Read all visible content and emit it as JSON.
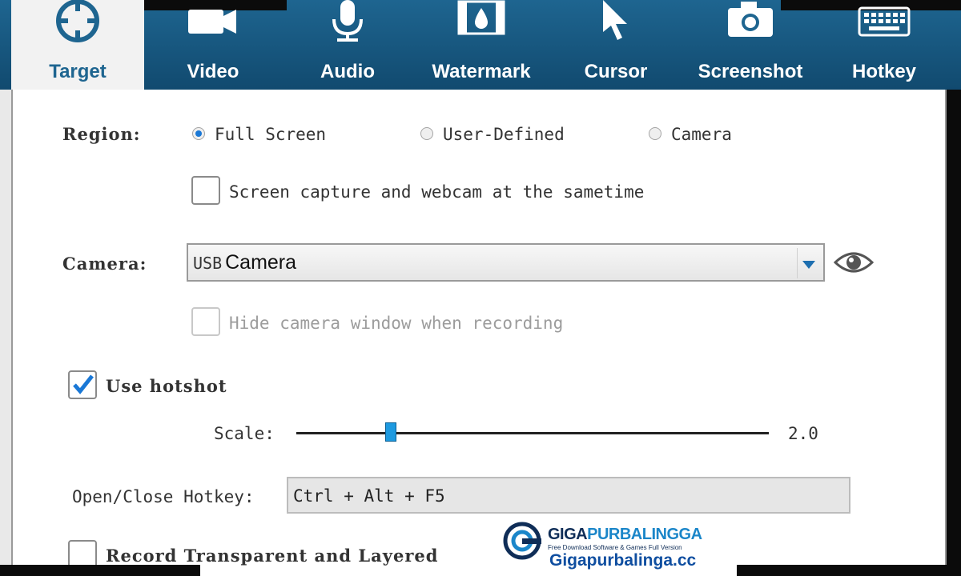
{
  "tabs": [
    {
      "label": "Target",
      "icon": "target-icon",
      "active": true
    },
    {
      "label": "Video",
      "icon": "video-camera-icon"
    },
    {
      "label": "Audio",
      "icon": "microphone-icon"
    },
    {
      "label": "Watermark",
      "icon": "watermark-film-icon"
    },
    {
      "label": "Cursor",
      "icon": "cursor-arrow-icon"
    },
    {
      "label": "Screenshot",
      "icon": "camera-icon"
    },
    {
      "label": "Hotkey",
      "icon": "keyboard-icon"
    }
  ],
  "region": {
    "label": "Region:",
    "options": [
      {
        "label": "Full Screen",
        "selected": true
      },
      {
        "label": "User-Defined",
        "selected": false
      },
      {
        "label": "Camera",
        "selected": false
      }
    ],
    "webcam_checkbox_label": "Screen capture and webcam at the sametime"
  },
  "camera": {
    "label": "Camera:",
    "value_prefix": "USB",
    "value": "Camera",
    "hide_window_label": "Hide camera window when recording"
  },
  "hotshot": {
    "label": "Use hotshot",
    "checked": true,
    "scale_label": "Scale:",
    "scale_value": "2.0",
    "scale_level": 0.2
  },
  "hotkey": {
    "label": "Open/Close Hotkey:",
    "value": "Ctrl + Alt + F5"
  },
  "record_label": "Record Transparent and Layered",
  "watermark": {
    "brand_main": "GIGA",
    "brand_accent": "PURBALINGGA",
    "tagline": "Free Download Software & Games Full Version",
    "site": "Gigapurbalinga.cc"
  },
  "colors": {
    "tab_bg": "#1e6590",
    "accent": "#1a78d6",
    "slider_thumb": "#1e9ae0"
  }
}
